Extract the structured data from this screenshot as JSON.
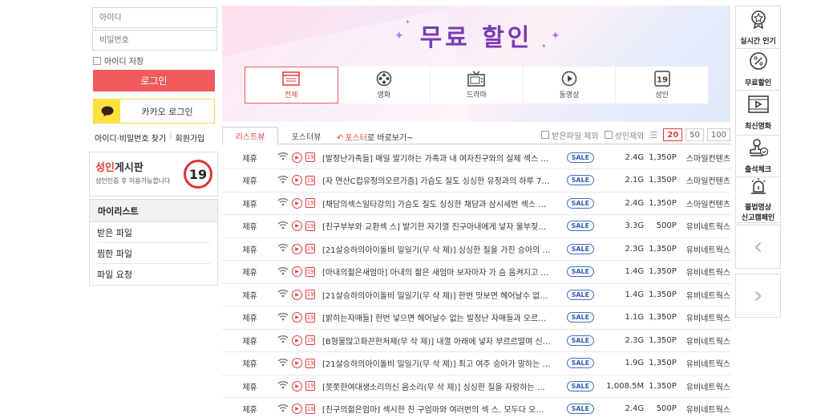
{
  "login": {
    "id_placeholder": "아이디",
    "pw_placeholder": "비밀번호",
    "remember_label": "아이디 저장",
    "login_button": "로그인",
    "kakao_button": "카카오 로그인",
    "find_link": "아이디·비밀번호 찾기",
    "join_link": "회원가입"
  },
  "adult_board": {
    "title_red": "성인",
    "title_rest": "게시판",
    "subtitle": "성인인증 후 이용가능합니다",
    "badge": "19"
  },
  "mylist": {
    "title": "마이리스트",
    "items": [
      "받은 파일",
      "찜한 파일",
      "파일 요청"
    ]
  },
  "banner": {
    "title": "무료 할인",
    "categories": [
      {
        "label": "전체",
        "icon": "list-window-icon"
      },
      {
        "label": "영화",
        "icon": "film-reel-icon"
      },
      {
        "label": "드라마",
        "icon": "tv-icon"
      },
      {
        "label": "동영상",
        "icon": "play-circle-icon"
      },
      {
        "label": "성인",
        "icon": "adult-19-icon"
      }
    ]
  },
  "listbar": {
    "tab_list": "리스트뷰",
    "tab_poster": "포스터뷰",
    "hint_red": "포스터",
    "hint_rest": "로 바로보기~",
    "filter_received": "받은파일 제외",
    "filter_adult": "성인제외",
    "page_sizes": [
      "20",
      "50",
      "100"
    ]
  },
  "colors": {
    "accent_red": "#f25a5d",
    "kakao_yellow": "#fde23b",
    "banner_purple": "#7b3bb5",
    "sale_blue": "#3f6fc4"
  },
  "files": [
    {
      "type": "제휴",
      "title": "[발정난가족들] 매일 발기하는 가족과 내 여자친구와의 실제 섹스 …",
      "sale": "SALE",
      "size": "2.4G",
      "price": "1,350P",
      "seller": "스마일컨텐츠"
    },
    {
      "type": "제휴",
      "title": "[자 연산C컵유정의오르가즘] 가슴도 질도 싱싱한 유정과의 하루 7…",
      "sale": "SALE",
      "size": "2.1G",
      "price": "1,350P",
      "seller": "스마일컨텐츠"
    },
    {
      "type": "제휴",
      "title": "[채담의섹스일타강의] 가슴도 질도 싱싱한 채담과 삼시세번 섹스 …",
      "sale": "SALE",
      "size": "2.4G",
      "price": "1,350P",
      "seller": "스마일컨텐츠"
    },
    {
      "type": "제휴",
      "title": "[친구부부와 교환섹 스] 발기한 자기껄 친구아내에게 넣자 울부짖…",
      "sale": "SALE",
      "size": "3.3G",
      "price": "500P",
      "seller": "유비네트웍스"
    },
    {
      "type": "제휴",
      "title": "[21살승하의아이돌비 밀일기(무 삭 제)] 싱싱한 질을 가진 승아의 …",
      "sale": "SALE",
      "size": "2.3G",
      "price": "1,350P",
      "seller": "유비네트웍스"
    },
    {
      "type": "제휴",
      "title": "[아내의젊은새엄마] 아내의 젊은 새엄마 보자마자 가 슴 움켜지고 …",
      "sale": "SALE",
      "size": "1.4G",
      "price": "1,350P",
      "seller": "유비네트웍스"
    },
    {
      "type": "제휴",
      "title": "[21살승하의아이돌비 밀일기(무 삭 제)] 한번 맛보면 헤어날수 없…",
      "sale": "SALE",
      "size": "1.4G",
      "price": "1,350P",
      "seller": "유비네트웍스"
    },
    {
      "type": "제휴",
      "title": "[밝히는자매들] 한번 넣으면 헤어날수 없는 발정난 자매들과 오르…",
      "sale": "SALE",
      "size": "1.1G",
      "price": "1,350P",
      "seller": "유비네트웍스"
    },
    {
      "type": "제휴",
      "title": "[B형물많고화끈한처제(무 삭 제)] 내껄 아래에 넣자 부르르떨며 신…",
      "sale": "SALE",
      "size": "2.3G",
      "price": "1,350P",
      "seller": "유비네트웍스"
    },
    {
      "type": "제휴",
      "title": "[21살승하의아이돌비 밀일기(무 삭 제)] 최고 여주 승아가 말하는 …",
      "sale": "SALE",
      "size": "1.9G",
      "price": "1,350P",
      "seller": "유비네트웍스"
    },
    {
      "type": "제휴",
      "title": "[쫏쫏한여대생소리의신 음소리(무 삭 제)] 싱싱한 질을 자랑하는 …",
      "sale": "SALE",
      "size": "1,008.5M",
      "price": "1,350P",
      "seller": "유비네트웍스"
    },
    {
      "type": "제휴",
      "title": "[친구의젊은엄마] 섹시한 친 구엄마와 여러번의 섹 스. 모두다 오…",
      "sale": "SALE",
      "size": "2.4G",
      "price": "500P",
      "seller": "유비네트웍스"
    }
  ],
  "quickmenu": [
    {
      "label": "실시간 인기",
      "icon": "medal-icon"
    },
    {
      "label": "무료할인",
      "icon": "discount-percent-icon"
    },
    {
      "label": "최신영화",
      "icon": "film-play-icon"
    },
    {
      "label": "출석체크",
      "icon": "stamp-check-icon"
    },
    {
      "label_line1": "불법영상",
      "label_line2": "신고캠페인",
      "icon": "siren-icon"
    }
  ]
}
